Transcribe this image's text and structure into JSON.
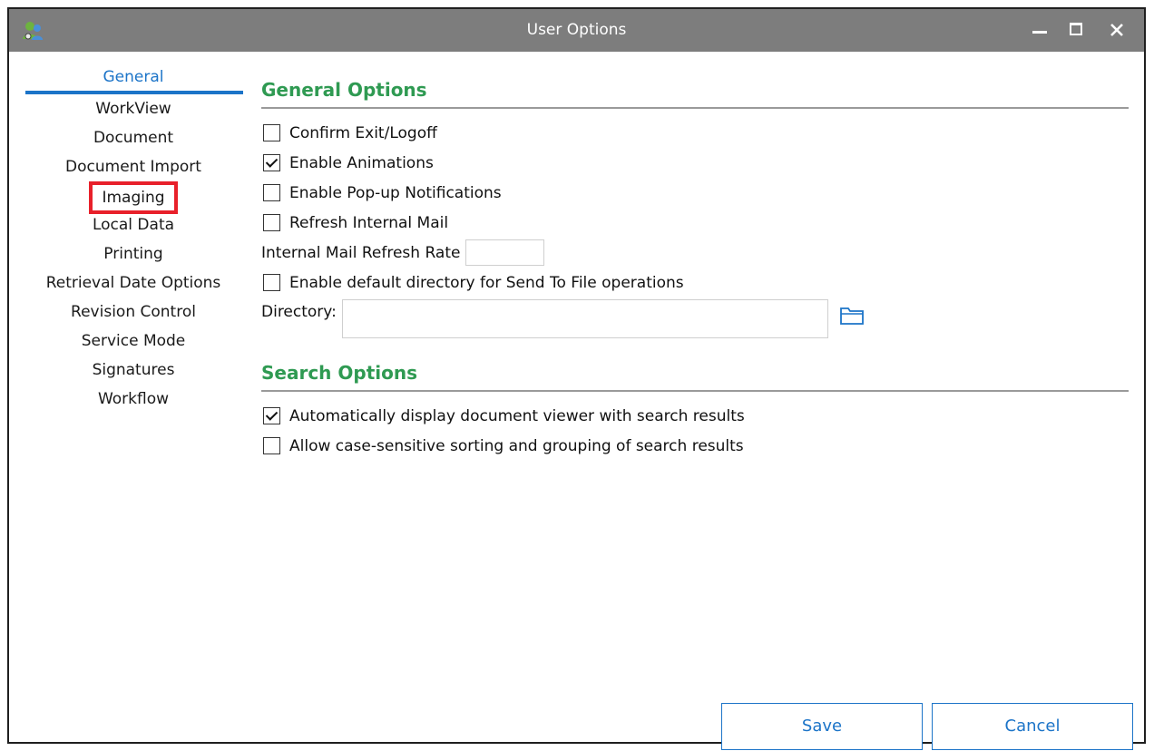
{
  "window": {
    "title": "User Options"
  },
  "sidebar": {
    "items": [
      {
        "label": "General"
      },
      {
        "label": "WorkView"
      },
      {
        "label": "Document"
      },
      {
        "label": "Document Import"
      },
      {
        "label": "Imaging"
      },
      {
        "label": "Local Data"
      },
      {
        "label": "Printing"
      },
      {
        "label": "Retrieval Date Options"
      },
      {
        "label": "Revision Control"
      },
      {
        "label": "Service Mode"
      },
      {
        "label": "Signatures"
      },
      {
        "label": "Workflow"
      }
    ],
    "active": "General",
    "highlighted": "Imaging"
  },
  "general_options": {
    "title": "General Options",
    "confirm_exit": {
      "label": "Confirm Exit/Logoff",
      "checked": false
    },
    "enable_animations": {
      "label": "Enable Animations",
      "checked": true
    },
    "popup_notifications": {
      "label": "Enable Pop-up Notifications",
      "checked": false
    },
    "refresh_mail": {
      "label": "Refresh Internal Mail",
      "checked": false
    },
    "refresh_rate_label": "Internal Mail Refresh Rate",
    "refresh_rate_value": "",
    "default_directory": {
      "label": "Enable default directory for Send To File operations",
      "checked": false
    },
    "directory_label": "Directory:",
    "directory_value": ""
  },
  "search_options": {
    "title": "Search Options",
    "auto_display_viewer": {
      "label": "Automatically display document viewer with search results",
      "checked": true
    },
    "case_sensitive_sorting": {
      "label": "Allow case-sensitive sorting and grouping of search results",
      "checked": false
    }
  },
  "buttons": {
    "save": "Save",
    "cancel": "Cancel"
  },
  "colors": {
    "titlebar": "#7d7d7d",
    "accent": "#1c74c8",
    "section_title": "#2f9a52",
    "highlight_box": "#e8202a"
  },
  "icons": [
    "user-options-app-icon",
    "minimize-icon",
    "maximize-icon",
    "close-icon",
    "folder-icon"
  ]
}
